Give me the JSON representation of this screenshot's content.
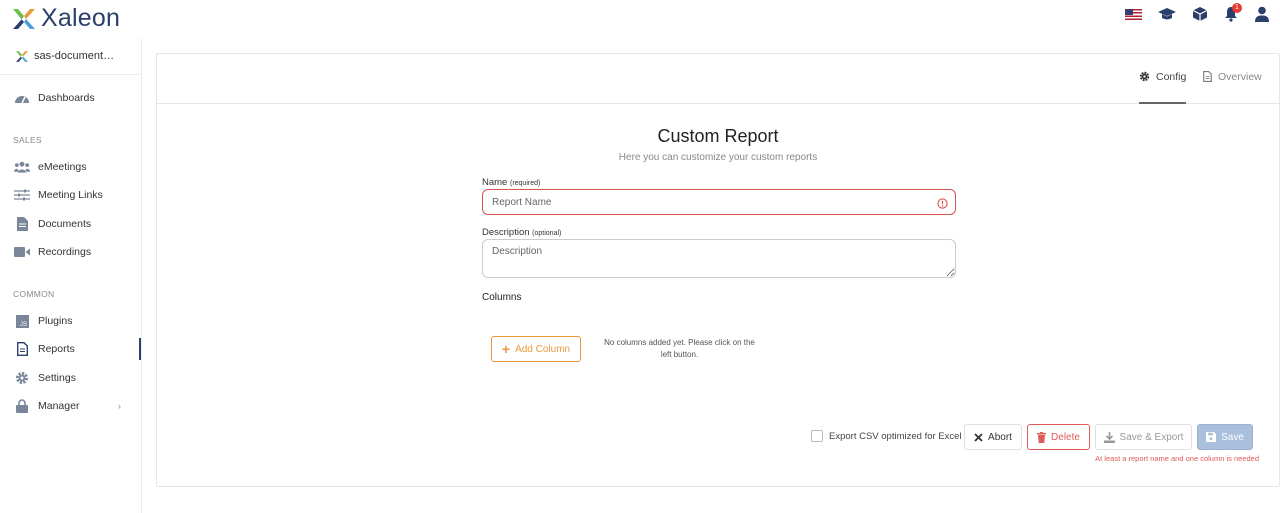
{
  "app": {
    "brand": "Xaleon"
  },
  "header": {
    "notification_count": "1"
  },
  "sidebar": {
    "project": "sas-documentati…",
    "dashboards": "Dashboards",
    "sections": {
      "sales": "SALES",
      "common": "COMMON"
    },
    "sales_items": [
      "eMeetings",
      "Meeting Links",
      "Documents",
      "Recordings"
    ],
    "common_items": [
      "Plugins",
      "Reports",
      "Settings",
      "Manager"
    ]
  },
  "tabs": {
    "config": "Config",
    "overview": "Overview"
  },
  "form": {
    "title": "Custom Report",
    "subtitle": "Here you can customize your custom reports",
    "name_label": "Name",
    "name_hint": "(required)",
    "name_placeholder": "Report Name",
    "name_value": "",
    "desc_label": "Description",
    "desc_hint": "(optional)",
    "desc_placeholder": "Description",
    "desc_value": "",
    "columns_label": "Columns",
    "add_column": "Add Column",
    "empty_note": "No columns added yet. Please click on the left button."
  },
  "footer": {
    "export_csv_label": "Export CSV optimized for Excel",
    "export_csv_checked": false,
    "abort": "Abort",
    "delete": "Delete",
    "save_export": "Save & Export",
    "save": "Save",
    "validation_hint": "At least a report name and one column is needed"
  },
  "colors": {
    "brand": "#2b3f6b",
    "accent_orange": "#e89a3c",
    "danger": "#e05a5a",
    "save_disabled": "#a9bfdc"
  }
}
